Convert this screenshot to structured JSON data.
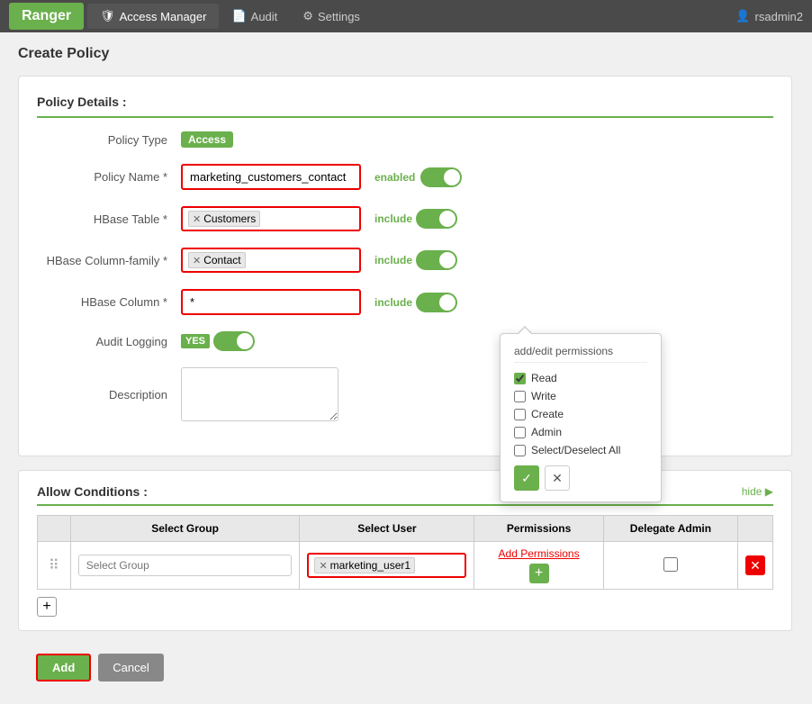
{
  "nav": {
    "brand": "Ranger",
    "items": [
      {
        "id": "access-manager",
        "label": "Access Manager",
        "icon": "🛡",
        "active": true
      },
      {
        "id": "audit",
        "label": "Audit",
        "icon": "📄",
        "active": false
      },
      {
        "id": "settings",
        "label": "Settings",
        "icon": "⚙",
        "active": false
      }
    ],
    "user": "rsadmin2",
    "user_icon": "👤"
  },
  "page": {
    "title": "Create Policy"
  },
  "policy_details": {
    "section_title": "Policy Details :",
    "policy_type_label": "Policy Type",
    "policy_type_badge": "Access",
    "policy_name_label": "Policy Name *",
    "policy_name_value": "marketing_customers_contact",
    "policy_name_enabled_label": "enabled",
    "hbase_table_label": "HBase Table *",
    "hbase_table_tag": "Customers",
    "hbase_table_include_label": "include",
    "hbase_column_family_label": "HBase Column-family *",
    "hbase_column_family_tag": "Contact",
    "hbase_column_family_include_label": "include",
    "hbase_column_label": "HBase Column *",
    "hbase_column_value": "*",
    "hbase_column_include_label": "include",
    "audit_logging_label": "Audit Logging",
    "audit_logging_value": "YES",
    "description_label": "Description",
    "description_placeholder": ""
  },
  "allow_conditions": {
    "section_title": "Allow Conditions :",
    "hide_label": "hide ▶",
    "col_select_group": "Select Group",
    "col_select_user": "Select User",
    "col_permissions": "Permissions",
    "col_delegate_admin": "Delegate Admin",
    "row": {
      "group_placeholder": "Select Group",
      "user_tag": "marketing_user1",
      "add_permissions_label": "Add Permissions",
      "add_plus": "+"
    }
  },
  "permissions_popup": {
    "title": "add/edit permissions",
    "options": [
      {
        "id": "read",
        "label": "Read",
        "checked": true
      },
      {
        "id": "write",
        "label": "Write",
        "checked": false
      },
      {
        "id": "create",
        "label": "Create",
        "checked": false
      },
      {
        "id": "admin",
        "label": "Admin",
        "checked": false
      },
      {
        "id": "select_deselect",
        "label": "Select/Deselect All",
        "checked": false
      }
    ],
    "confirm_icon": "✓",
    "cancel_icon": "✕"
  },
  "buttons": {
    "add_label": "Add",
    "cancel_label": "Cancel"
  }
}
